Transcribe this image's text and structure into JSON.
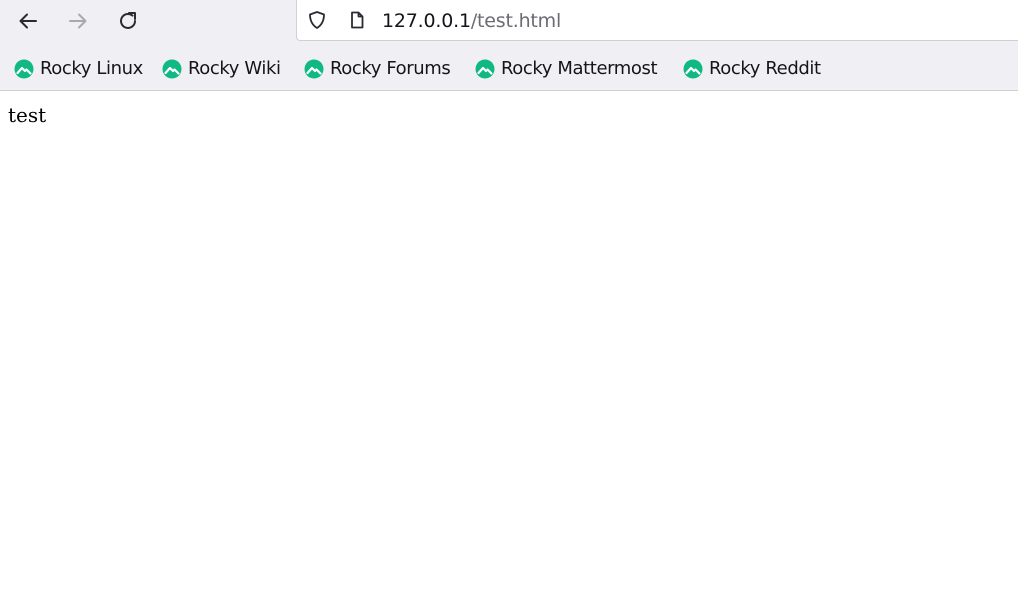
{
  "browser": {
    "nav": {
      "back_icon": "arrow-left-icon",
      "forward_icon": "arrow-right-icon",
      "reload_icon": "reload-icon"
    },
    "urlbar": {
      "security_icon": "shield-icon",
      "page_icon": "document-icon",
      "host": "127.0.0.1",
      "path": "/test.html"
    },
    "bookmarks": [
      {
        "label": "Rocky Linux",
        "icon": "rocky-logo-icon"
      },
      {
        "label": "Rocky Wiki",
        "icon": "rocky-logo-icon"
      },
      {
        "label": "Rocky Forums",
        "icon": "rocky-logo-icon"
      },
      {
        "label": "Rocky Mattermost",
        "icon": "rocky-logo-icon"
      },
      {
        "label": "Rocky Reddit",
        "icon": "rocky-logo-icon"
      }
    ],
    "colors": {
      "toolbar_bg": "#f0f0f4",
      "bookmark_icon": "#10b981",
      "forward_disabled": "#a8a8ae"
    }
  },
  "page": {
    "body_text": "test"
  }
}
